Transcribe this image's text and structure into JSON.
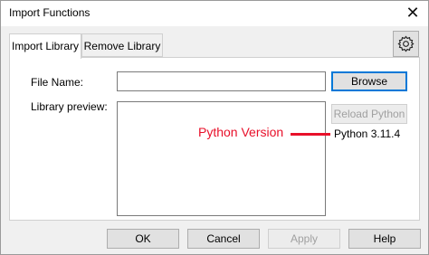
{
  "window": {
    "title": "Import Functions",
    "close_glyph": "✕"
  },
  "tabs": [
    {
      "label": "Import Library",
      "active": true
    },
    {
      "label": "Remove Library",
      "active": false
    }
  ],
  "settings_icon": "gear-icon",
  "form": {
    "file_name_label": "File Name:",
    "file_name_value": "",
    "library_preview_label": "Library preview:",
    "browse_label": "Browse",
    "reload_label": "Reload Python",
    "python_version": "Python 3.11.4"
  },
  "annotation": {
    "text": "Python Version",
    "color": "#e8102a"
  },
  "footer": {
    "ok_label": "OK",
    "cancel_label": "Cancel",
    "apply_label": "Apply",
    "help_label": "Help"
  }
}
